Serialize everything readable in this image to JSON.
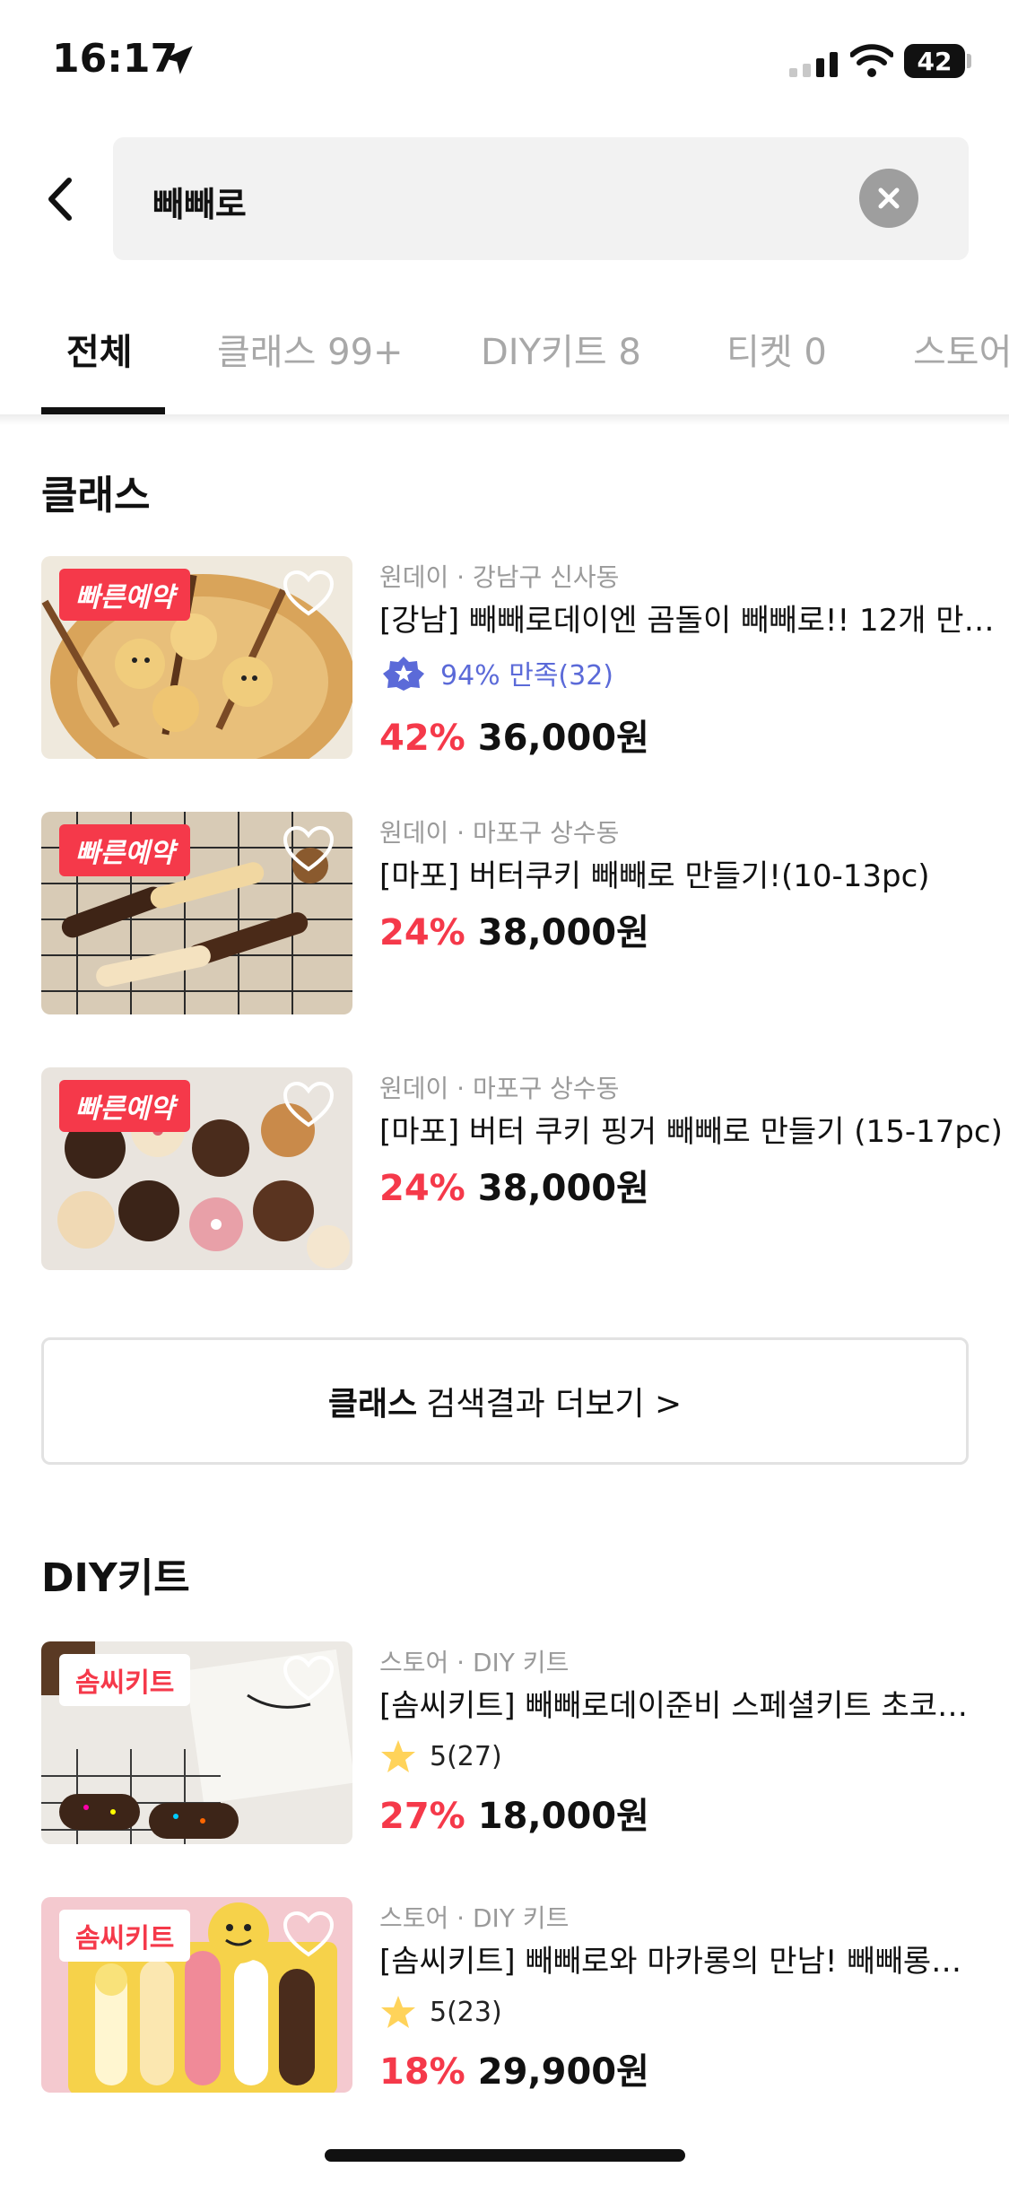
{
  "status_bar": {
    "time": "16:17",
    "battery": "42"
  },
  "search": {
    "query": "빼빼로"
  },
  "tabs": [
    {
      "label": "전체",
      "active": true
    },
    {
      "label": "클래스 99+",
      "active": false
    },
    {
      "label": "DIY키트 8",
      "active": false
    },
    {
      "label": "티켓 0",
      "active": false
    },
    {
      "label": "스토어",
      "active": false
    }
  ],
  "class_section": {
    "title": "클래스",
    "items": [
      {
        "badge": "빠른예약",
        "meta": "원데이 · 강남구 신사동",
        "title": "[강남] 빼빼로데이엔 곰돌이 빼빼로!! 12개 만…",
        "rating": "94% 만족(32)",
        "discount": "42%",
        "price": "36,000원"
      },
      {
        "badge": "빠른예약",
        "meta": "원데이 · 마포구 상수동",
        "title": "[마포] 버터쿠키 빼빼로 만들기!(10-13pc)",
        "discount": "24%",
        "price": "38,000원"
      },
      {
        "badge": "빠른예약",
        "meta": "원데이 · 마포구 상수동",
        "title": "[마포] 버터 쿠키 핑거 빼빼로 만들기 (15-17pc)",
        "discount": "24%",
        "price": "38,000원"
      }
    ],
    "more_bold": "클래스",
    "more_rest": "검색결과 더보기 >"
  },
  "kit_section": {
    "title": "DIY키트",
    "items": [
      {
        "badge": "솜씨키트",
        "meta": "스토어 · DIY 키트",
        "title": "[솜씨키트] 빼빼로데이준비 스페셜키트 초코…",
        "rating": "5(27)",
        "discount": "27%",
        "price": "18,000원"
      },
      {
        "badge": "솜씨키트",
        "meta": "스토어 · DIY 키트",
        "title": "[솜씨키트] 빼빼로와 마카롱의 만남! 빼빼롱…",
        "rating": "5(23)",
        "discount": "18%",
        "price": "29,900원"
      }
    ]
  },
  "colors": {
    "accent_red": "#f5394a",
    "satisfaction_blue": "#5b6ad8",
    "star_yellow": "#ffd35a",
    "tab_inactive": "#a8a8a8"
  }
}
